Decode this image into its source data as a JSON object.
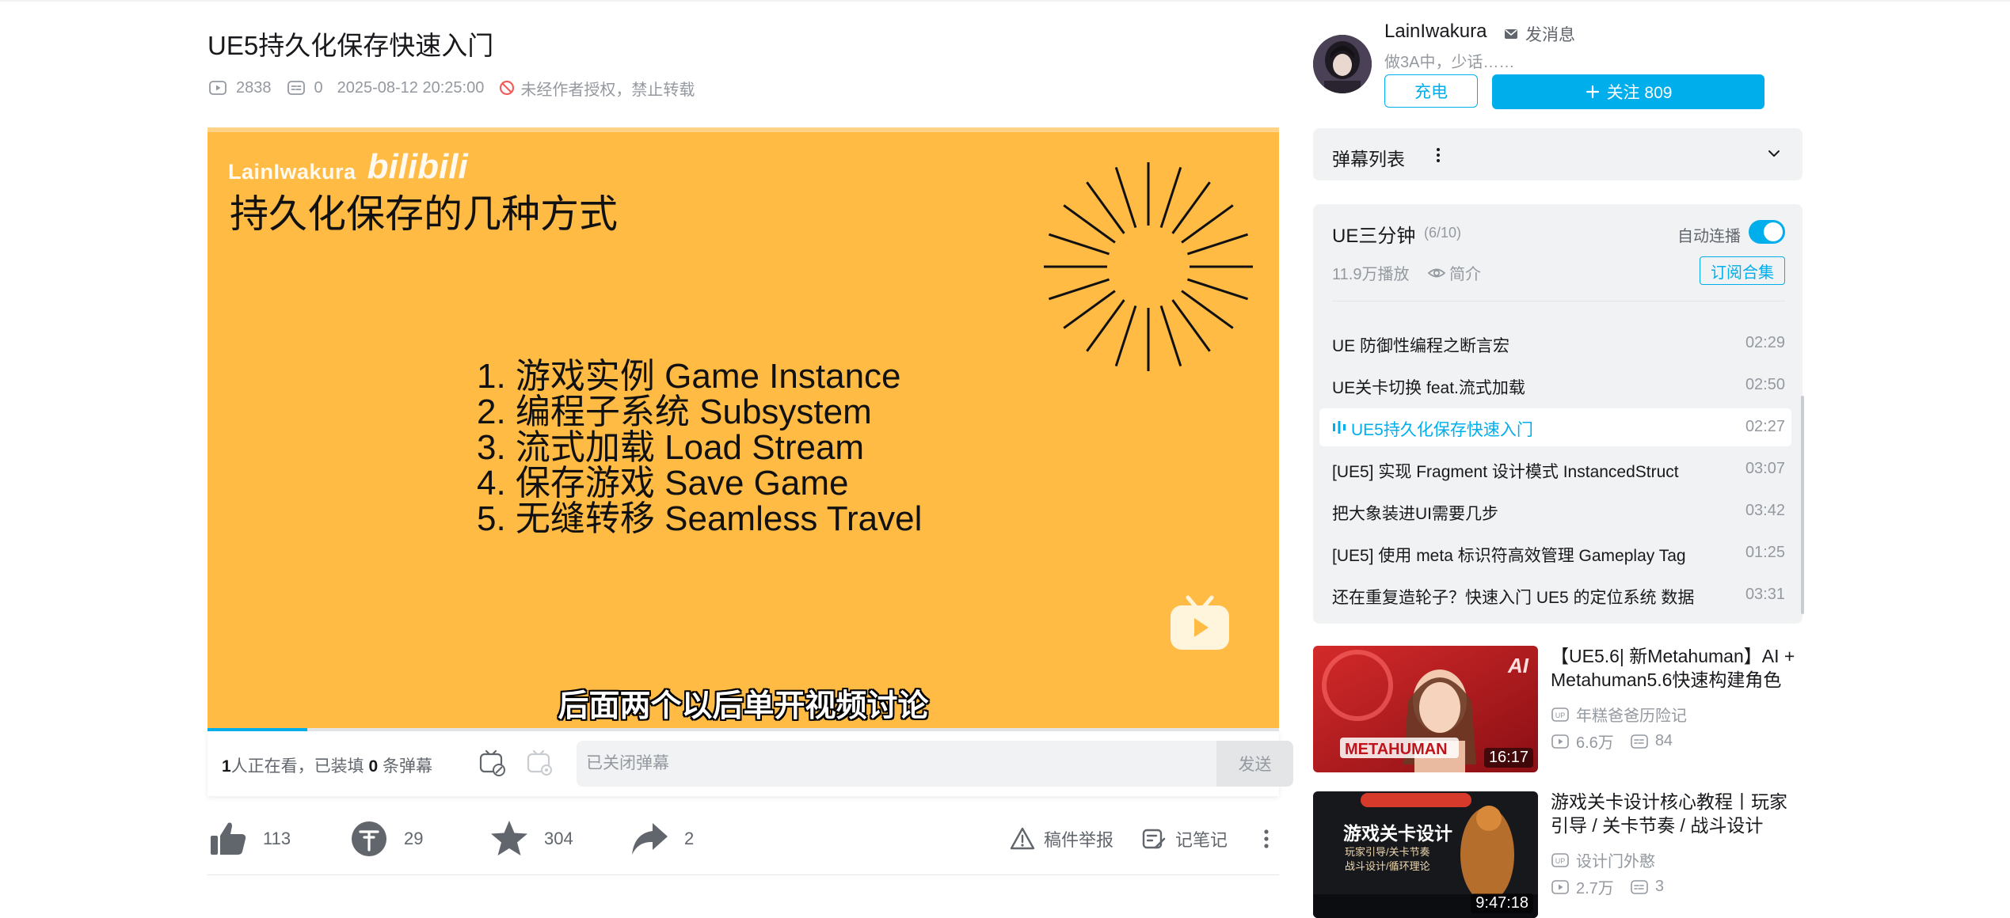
{
  "video": {
    "title": "UE5持久化保存快速入门",
    "views": "2838",
    "danmaku_count": "0",
    "publish_time": "2025-08-12 20:25:00",
    "copyright": "未经作者授权，禁止转载"
  },
  "player": {
    "brand_name": "LainIwakura",
    "brand_logo": "bilibili",
    "slide_title": "持久化保存的几种方式",
    "slide_items": [
      "1. 游戏实例 Game Instance",
      "2. 编程子系统 Subsystem",
      "3. 流式加载 Load Stream",
      "4. 保存游戏 Save Game",
      "5. 无缝转移 Seamless Travel"
    ],
    "subtitle": "后面两个以后单开视频讨论",
    "progress": 0.093,
    "accent_color": "#ffbb44"
  },
  "danmaku_bar": {
    "viewers_num": "1",
    "viewers_text1": "人正在看，已装填 ",
    "loaded_num": "0",
    "viewers_text2": " 条弹幕",
    "input_placeholder": "已关闭弹幕",
    "send_label": "发送"
  },
  "actions": {
    "like": "113",
    "coin": "29",
    "favorite": "304",
    "share": "2",
    "report": "稿件举报",
    "notes": "记笔记"
  },
  "uploader": {
    "name": "LainIwakura",
    "message": "发消息",
    "desc": "做3A中，少话……",
    "charge": "充电",
    "follow": "关注 809"
  },
  "danmaku_list": {
    "label": "弹幕列表"
  },
  "collection": {
    "title": "UE三分钟",
    "count": "(6/10)",
    "autoplay_label": "自动连播",
    "autoplay_on": true,
    "plays": "11.9万播放",
    "intro": "简介",
    "subscribe": "订阅合集",
    "episodes": [
      {
        "title": "UE 防御性编程之断言宏",
        "duration": "02:29",
        "active": false
      },
      {
        "title": "UE关卡切换 feat.流式加载",
        "duration": "02:50",
        "active": false
      },
      {
        "title": "UE5持久化保存快速入门",
        "duration": "02:27",
        "active": true
      },
      {
        "title": "[UE5] 实现 Fragment 设计模式 InstancedStruct",
        "duration": "03:07",
        "active": false
      },
      {
        "title": "把大象装进UI需要几步",
        "duration": "03:42",
        "active": false
      },
      {
        "title": "[UE5] 使用 meta 标识符高效管理 Gameplay Tag",
        "duration": "01:25",
        "active": false
      },
      {
        "title": "还在重复造轮子？快速入门 UE5 的定位系统 数据",
        "duration": "03:31",
        "active": false
      }
    ]
  },
  "recommendations": [
    {
      "title": "【UE5.6| 新Metahuman】AI + Metahuman5.6快速构建角色",
      "owner": "年糕爸爸历险记",
      "views": "6.6万",
      "comments": "84",
      "duration": "16:17",
      "thumb_text1": "AI",
      "thumb_text2": "METAHUMAN"
    },
    {
      "title": "游戏关卡设计核心教程丨玩家引导 / 关卡节奏 / 战斗设计",
      "owner": "设计门外憨",
      "views": "2.7万",
      "comments": "3",
      "duration": "9:47:18",
      "thumb_text1": "游戏关卡设计",
      "thumb_text2": "玩家引导/关卡节奏",
      "thumb_text3": "战斗设计/循环理论"
    }
  ]
}
